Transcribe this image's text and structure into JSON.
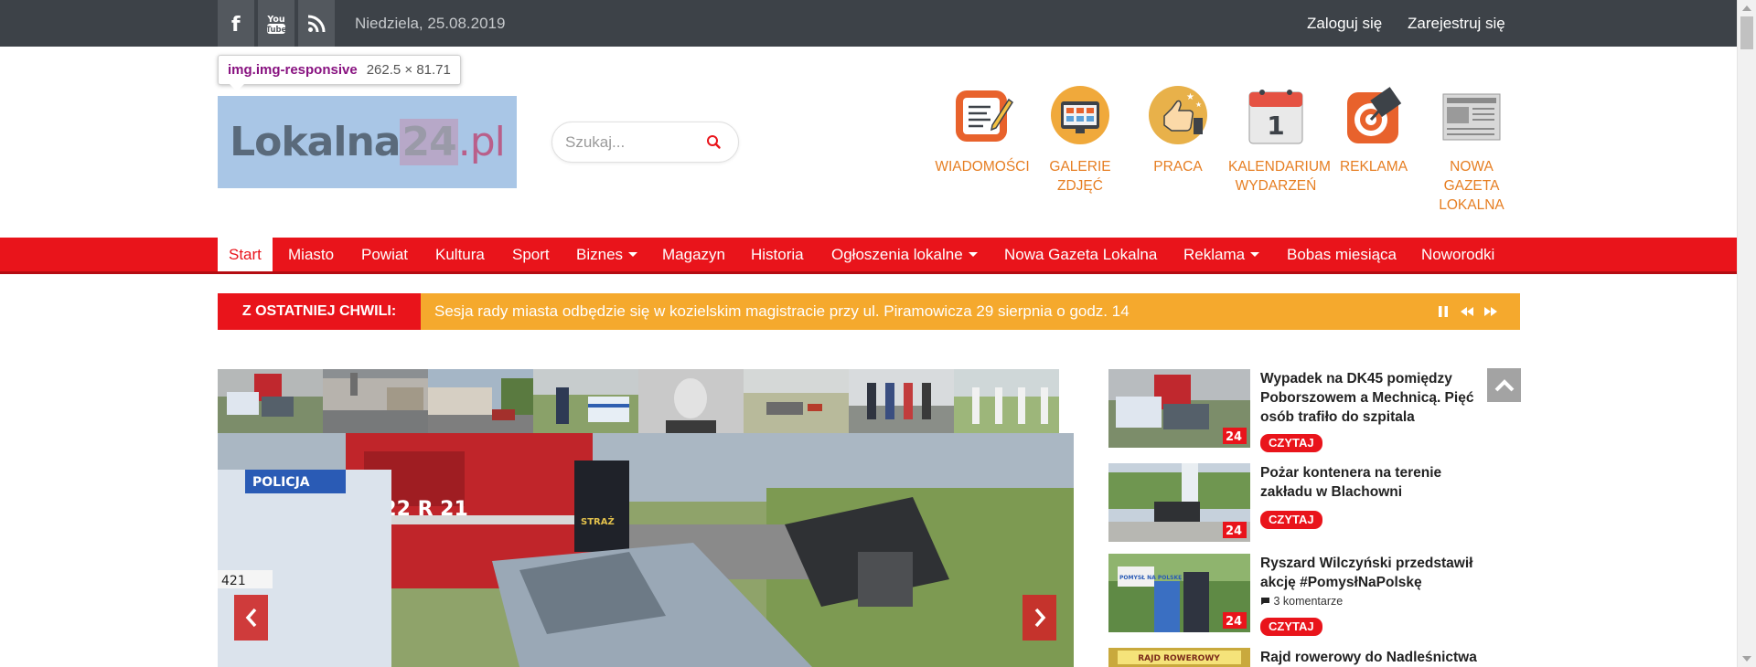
{
  "topbar": {
    "social": [
      {
        "icon": "facebook-icon",
        "glyph": "f"
      },
      {
        "icon": "youtube-icon",
        "glyph": "You Tube"
      },
      {
        "icon": "rss-icon",
        "glyph": ""
      }
    ],
    "date": "Niedziela, 25.08.2019",
    "login": "Zaloguj się",
    "register": "Zarejestruj się"
  },
  "inspector": {
    "selector": "img.img-responsive",
    "dimensions": "262.5 × 81.71"
  },
  "logo": {
    "part1": "Lokalna",
    "part2": "24",
    "part3": ".pl"
  },
  "search": {
    "placeholder": "Szukaj...",
    "icon": "search-icon"
  },
  "categories": [
    {
      "label": "WIADOMOŚCI",
      "icon": "news-icon"
    },
    {
      "label": "GALERIE ZDJĘĆ",
      "icon": "gallery-icon"
    },
    {
      "label": "PRACA",
      "icon": "job-icon"
    },
    {
      "label": "KALENDARIUM WYDARZEŃ",
      "icon": "calendar-icon"
    },
    {
      "label": "REKLAMA",
      "icon": "advertising-icon"
    },
    {
      "label": "NOWA GAZETA LOKALNA",
      "icon": "newspaper-icon"
    }
  ],
  "calendar_day": "1",
  "nav": [
    {
      "label": "Start",
      "active": true
    },
    {
      "label": "Miasto"
    },
    {
      "label": "Powiat"
    },
    {
      "label": "Kultura"
    },
    {
      "label": "Sport"
    },
    {
      "label": "Biznes",
      "dropdown": true
    },
    {
      "label": "Magazyn"
    },
    {
      "label": "Historia"
    },
    {
      "label": "Ogłoszenia lokalne",
      "dropdown": true
    },
    {
      "label": "Nowa Gazeta Lokalna"
    },
    {
      "label": "Reklama",
      "dropdown": true
    },
    {
      "label": "Bobas miesiąca"
    },
    {
      "label": "Noworodki"
    }
  ],
  "breaking": {
    "label": "Z OSTATNIEJ CHWILI:",
    "text": "Sesja rady miasta odbędzie się w kozielskim magistracie przy ul. Piramowicza 29 sierpnia o godz. 14",
    "controls": [
      "pause-icon",
      "rewind-icon",
      "fast-forward-icon"
    ]
  },
  "slider": {
    "prev_icon": "chevron-left-icon",
    "next_icon": "chevron-right-icon",
    "image_text": {
      "license_plate": "422 R 21",
      "police": "POLICJA",
      "side_number": "421",
      "straz": "STRAŻ"
    }
  },
  "news": [
    {
      "title": "Wypadek na DK45 pomiędzy Poborszowem a Mechnicą. Pięć osób trafiło do szpitala",
      "comments": "",
      "button": "CZYTAJ"
    },
    {
      "title": "Pożar kontenera na terenie zakładu w Blachowni",
      "comments": "",
      "button": "CZYTAJ"
    },
    {
      "title": "Ryszard Wilczyński przedstawił akcję #PomysłNaPolskę",
      "comments": "3 komentarze",
      "button": "CZYTAJ"
    },
    {
      "title": "Rajd rowerowy do Nadleśnictwa",
      "comments": "",
      "button": ""
    }
  ],
  "thumb_badge": "24",
  "news_image_text": {
    "rajd": "RAJD ROWEROWY",
    "pomysl": "POMYSŁ NA POLSKĘ"
  },
  "colors": {
    "accent_red": "#e9141b",
    "orange": "#f5a92d",
    "topbar": "#3d4248",
    "category_label": "#e67e22"
  }
}
